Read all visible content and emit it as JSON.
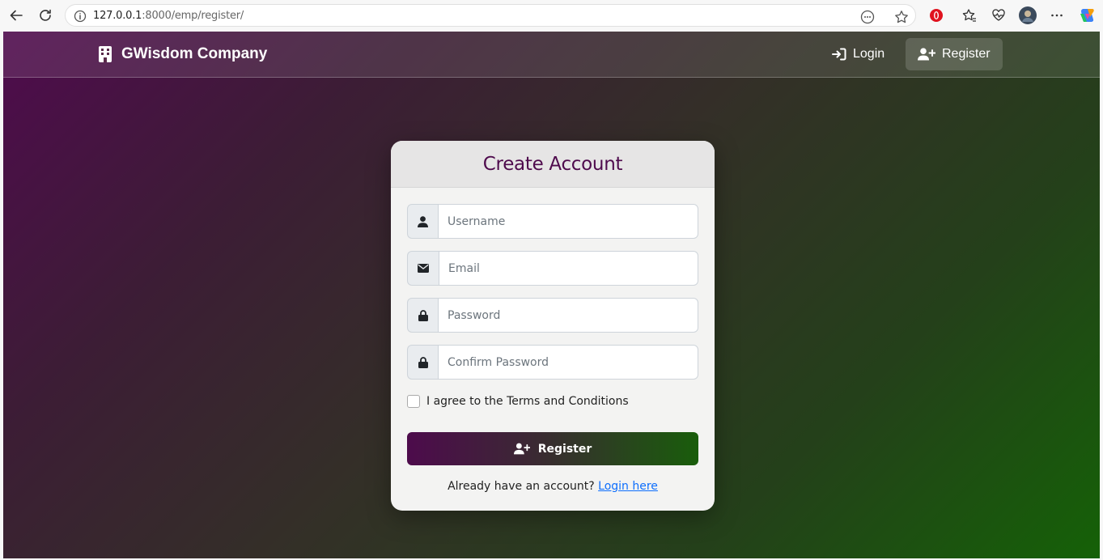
{
  "browser": {
    "url_host": "127.0.0.1",
    "url_rest": ":8000/emp/register/"
  },
  "navbar": {
    "brand": "GWisdom Company",
    "login_label": "Login",
    "register_label": "Register"
  },
  "card": {
    "title": "Create Account",
    "username_placeholder": "Username",
    "email_placeholder": "Email",
    "password_placeholder": "Password",
    "confirm_placeholder": "Confirm Password",
    "terms_label": "I agree to the Terms and Conditions",
    "submit_label": "Register",
    "footer_prefix": "Already have an account? ",
    "footer_link": "Login here"
  },
  "colors": {
    "title": "#4f0b4d",
    "gradient_start": "#4f0b4d",
    "gradient_end": "#156107",
    "link": "#0d6efd"
  }
}
